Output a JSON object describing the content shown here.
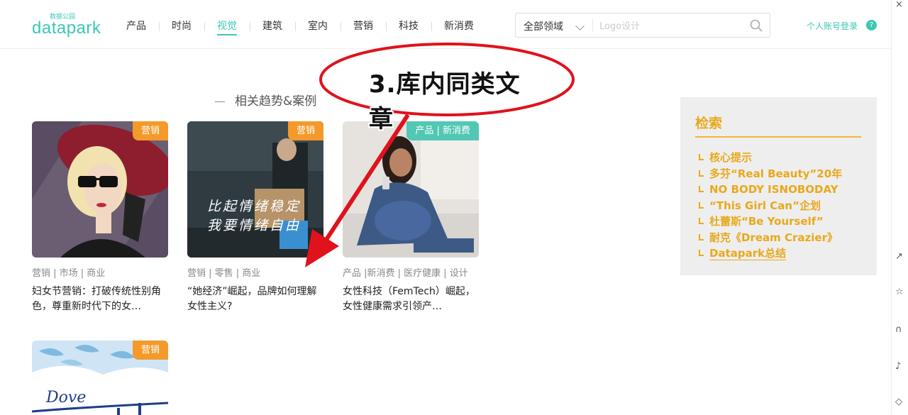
{
  "header": {
    "logo_small": "数据公园",
    "logo_main": "datapark",
    "nav": [
      {
        "label": "产品",
        "active": false
      },
      {
        "label": "时尚",
        "active": false
      },
      {
        "label": "视觉",
        "active": true
      },
      {
        "label": "建筑",
        "active": false
      },
      {
        "label": "室内",
        "active": false
      },
      {
        "label": "营销",
        "active": false
      },
      {
        "label": "科技",
        "active": false
      },
      {
        "label": "新消费",
        "active": false
      }
    ],
    "search": {
      "category": "全部领域",
      "placeholder": "Logo设计",
      "value": ""
    },
    "login": "个人账号登录",
    "help": "?"
  },
  "section_title": "相关趋势&案例",
  "annotation": "3.库内同类文章",
  "cards": [
    {
      "badge": "营销",
      "tags": "营销 | 市场 | 商业",
      "title": "妇女节营销：打破传统性别角色，尊重新时代下的女…"
    },
    {
      "badge": "营销",
      "tags": "营销 | 零售 | 商业",
      "title": "“她经济”崛起，品牌如何理解女性主义?",
      "image_text_1": "比起情绪稳定",
      "image_text_2": "我要情绪自由"
    },
    {
      "badge": "产品 | 新消费",
      "tags": "产品 |新消费 | 医疗健康 | 设计",
      "title": "女性科技（FemTech）崛起，女性健康需求引领产…"
    },
    {
      "badge": "营销",
      "image_text": "Dove"
    }
  ],
  "panel": {
    "title": "检索",
    "items": [
      "核心提示",
      "多芬“Real Beauty”20年",
      "NO BODY ISNOBODAY",
      "“This Girl Can”企划",
      "杜蕾斯“Be Yourself”",
      "耐克《Dream Crazier》",
      "Datapark总结"
    ]
  },
  "colors": {
    "accent": "#3cc7b4",
    "badge_orange": "#f39a2b",
    "badge_teal": "#52c7b4",
    "panel_gold": "#e8a91c",
    "annotation_red": "#e0121b"
  }
}
